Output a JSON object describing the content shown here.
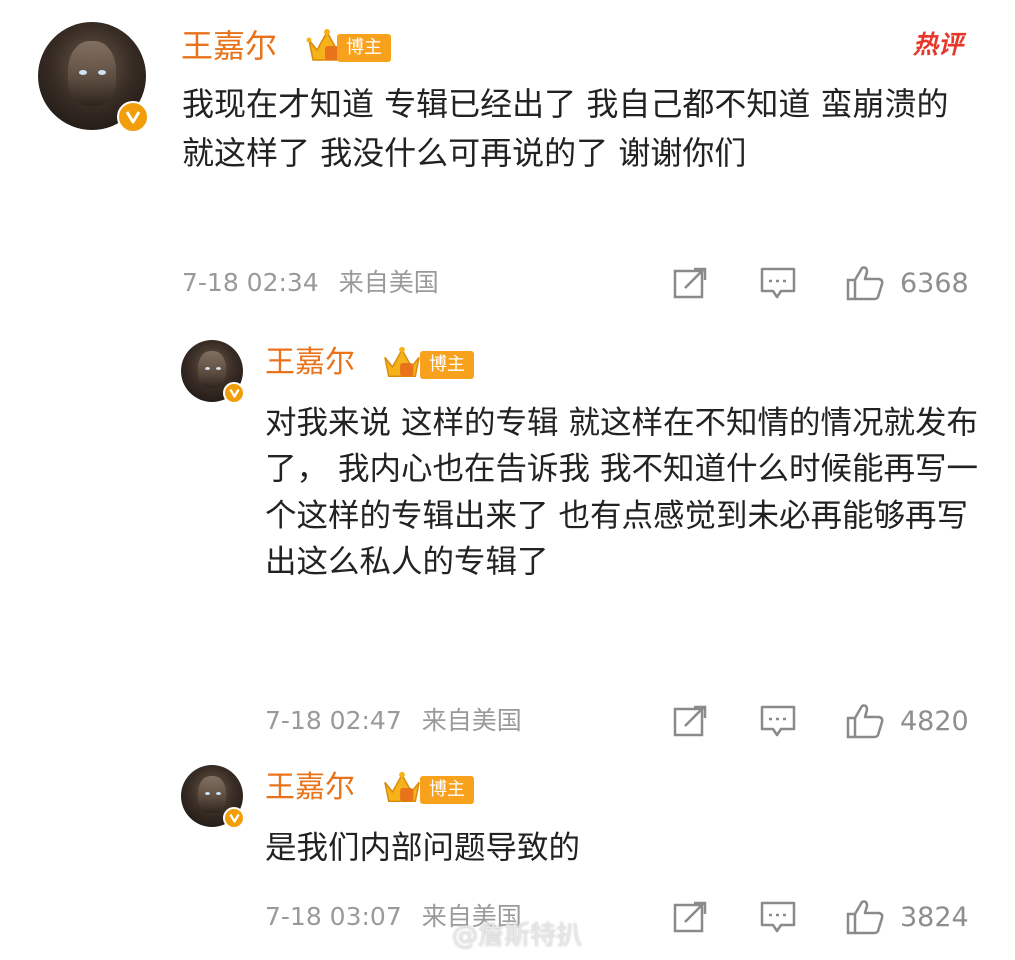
{
  "hot_label": "热评",
  "badge_label": "博主",
  "watermark": "@詹斯特扒",
  "colors": {
    "name": "#e8731a",
    "badge": "#f7a11c",
    "verified": "#f29d0a",
    "hot": "#e8362a"
  },
  "icons": [
    "crown-icon",
    "verified-icon",
    "share-icon",
    "comment-icon",
    "like-icon"
  ],
  "comments": [
    {
      "author": "王嘉尔",
      "text": "我现在才知道 专辑已经出了 我自己都不知道 蛮崩溃的  就这样了 我没什么可再说的了  谢谢你们",
      "time": "7-18 02:34",
      "location": "来自美国",
      "likes": "6368"
    },
    {
      "author": "王嘉尔",
      "text": "对我来说 这样的专辑 就这样在不知情的情况就发布了， 我内心也在告诉我 我不知道什么时候能再写一个这样的专辑出来了 也有点感觉到未必再能够再写出这么私人的专辑了",
      "time": "7-18 02:47",
      "location": "来自美国",
      "likes": "4820"
    },
    {
      "author": "王嘉尔",
      "text": "是我们内部问题导致的",
      "time": "7-18 03:07",
      "location": "来自美国",
      "likes": "3824"
    }
  ]
}
